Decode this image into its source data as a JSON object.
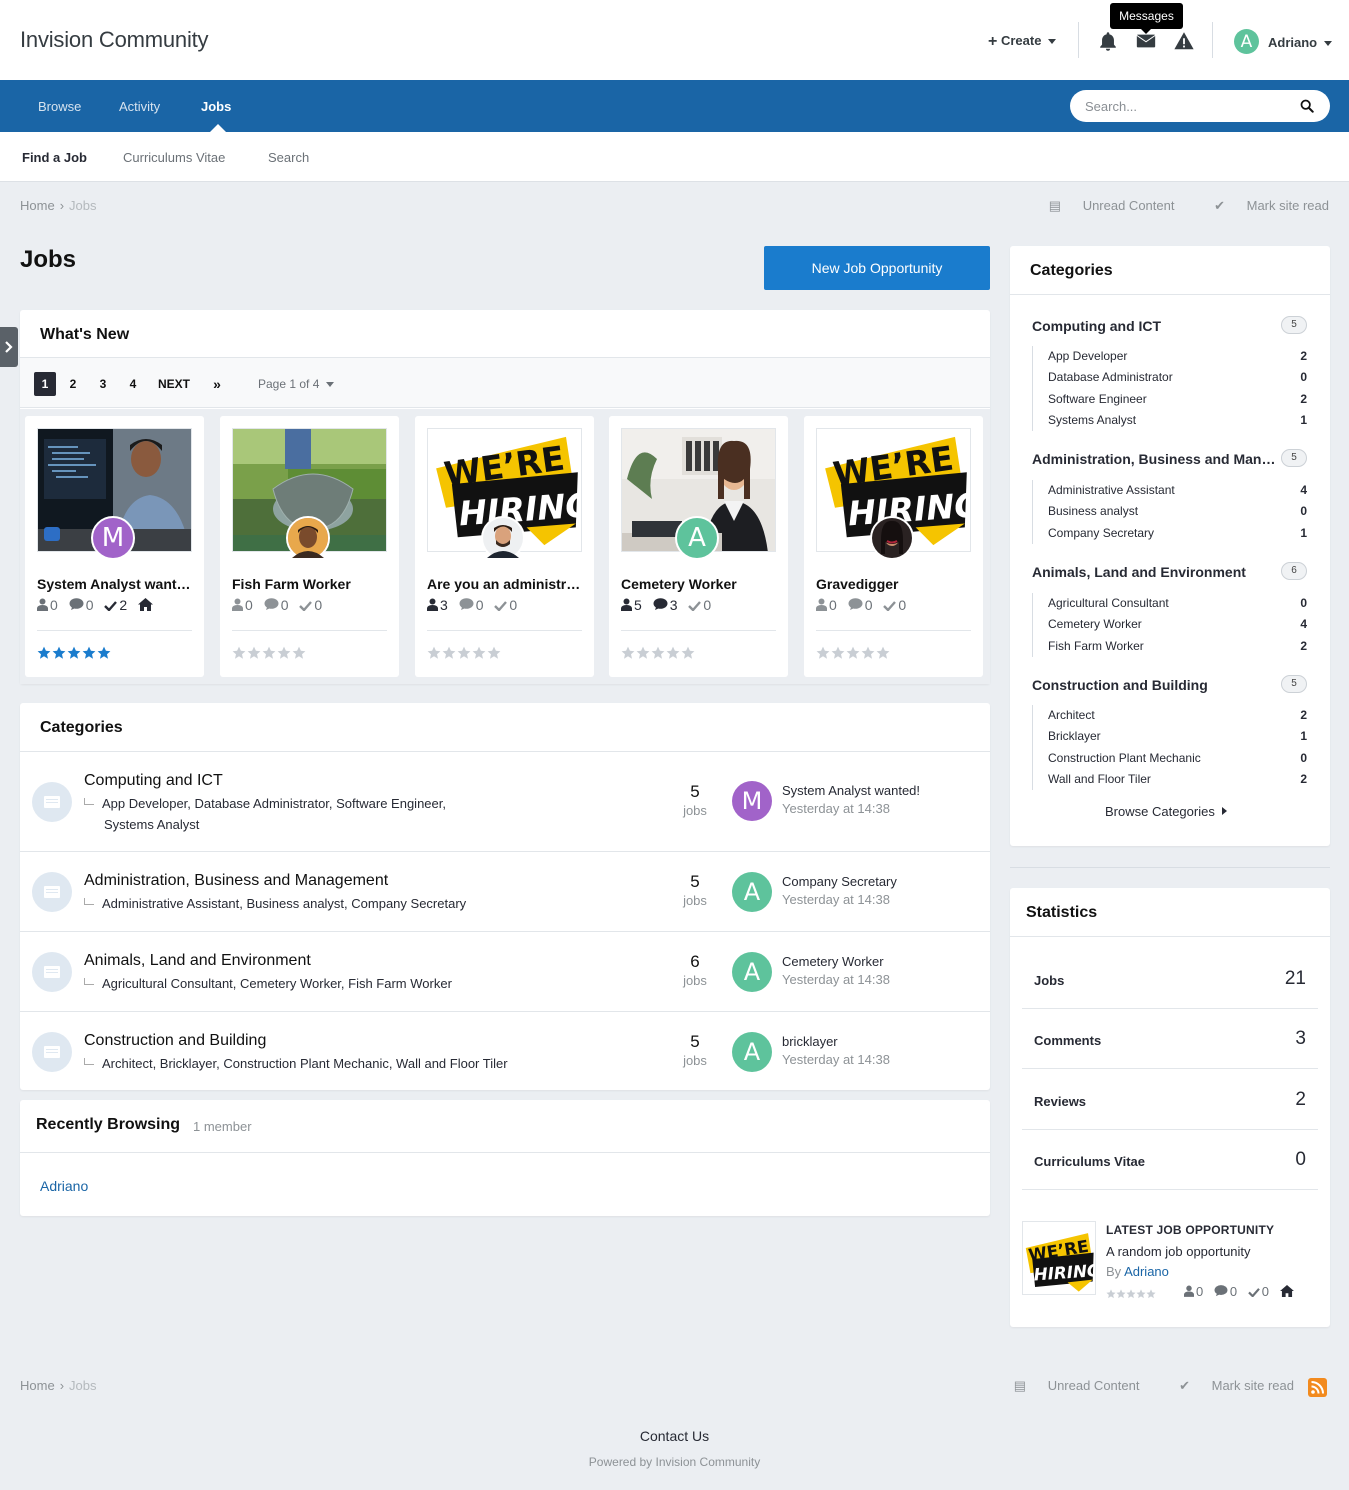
{
  "header": {
    "site_title": "Invision Community",
    "create_label": "Create",
    "tooltip": "Messages",
    "user_initial": "A",
    "user_name": "Adriano"
  },
  "nav": {
    "items": [
      "Browse",
      "Activity",
      "Jobs"
    ],
    "active": "Jobs",
    "search_placeholder": "Search..."
  },
  "subnav": {
    "items": [
      "Find a Job",
      "Curriculums Vitae",
      "Search"
    ],
    "active": "Find a Job"
  },
  "breadcrumb": {
    "home": "Home",
    "current": "Jobs",
    "unread": "Unread Content",
    "mark_read": "Mark site read"
  },
  "page": {
    "title": "Jobs",
    "new_button": "New Job Opportunity"
  },
  "whats_new": {
    "title": "What's New",
    "pages": [
      "1",
      "2",
      "3",
      "4"
    ],
    "next": "NEXT",
    "page_of": "Page 1 of 4",
    "cards": [
      {
        "title": "System Analyst wanted!",
        "avatar": "M",
        "avatar_color": "#a163c9",
        "stats": {
          "users": "0",
          "comments": "0",
          "checks": "2"
        },
        "featured": true,
        "rating": 5
      },
      {
        "title": "Fish Farm Worker",
        "avatar": "",
        "avatar_color": "#c57b3b",
        "stats": {
          "users": "0",
          "comments": "0",
          "checks": "0"
        },
        "featured": false,
        "rating": 0
      },
      {
        "title": "Are you an administrator?",
        "avatar": "",
        "avatar_color": "#6b4a3b",
        "stats": {
          "users": "3",
          "comments": "0",
          "checks": "0"
        },
        "featured": false,
        "rating": 0
      },
      {
        "title": "Cemetery Worker",
        "avatar": "A",
        "avatar_color": "#5ec39c",
        "stats": {
          "users": "5",
          "comments": "3",
          "checks": "0"
        },
        "featured": false,
        "rating": 0
      },
      {
        "title": "Gravedigger",
        "avatar": "",
        "avatar_color": "#4a2a2a",
        "stats": {
          "users": "0",
          "comments": "0",
          "checks": "0"
        },
        "featured": false,
        "rating": 0
      }
    ]
  },
  "hiring_text": {
    "line1": "WE’RE",
    "line2": "HIRING"
  },
  "categories": {
    "title": "Categories",
    "unit": "jobs",
    "rows": [
      {
        "name": "Computing and ICT",
        "subs": "App Developer,  Database Administrator,  Software Engineer,",
        "subs2": "Systems Analyst",
        "count": "5",
        "last_title": "System Analyst wanted!",
        "last_time": "Yesterday at 14:38",
        "avatar": "M",
        "avatar_color": "#a163c9"
      },
      {
        "name": "Administration, Business and Management",
        "subs": "Administrative Assistant,  Business analyst,  Company Secretary",
        "subs2": "",
        "count": "5",
        "last_title": "Company Secretary",
        "last_time": "Yesterday at 14:38",
        "avatar": "A",
        "avatar_color": "#5ec39c"
      },
      {
        "name": "Animals, Land and Environment",
        "subs": "Agricultural Consultant,  Cemetery Worker,  Fish Farm Worker",
        "subs2": "",
        "count": "6",
        "last_title": "Cemetery Worker",
        "last_time": "Yesterday at 14:38",
        "avatar": "A",
        "avatar_color": "#5ec39c"
      },
      {
        "name": "Construction and Building",
        "subs": "Architect,  Bricklayer,  Construction Plant Mechanic,  Wall and Floor Tiler",
        "subs2": "",
        "count": "5",
        "last_title": "bricklayer",
        "last_time": "Yesterday at 14:38",
        "avatar": "A",
        "avatar_color": "#5ec39c"
      }
    ]
  },
  "recently": {
    "title": "Recently Browsing",
    "count": "1 member",
    "user": "Adriano"
  },
  "side_categories": {
    "title": "Categories",
    "groups": [
      {
        "name": "Computing and ICT",
        "count": "5",
        "items": [
          [
            "App Developer",
            "2"
          ],
          [
            "Database Administrator",
            "0"
          ],
          [
            "Software Engineer",
            "2"
          ],
          [
            "Systems Analyst",
            "1"
          ]
        ]
      },
      {
        "name": "Administration, Business and Management",
        "count": "5",
        "items": [
          [
            "Administrative Assistant",
            "4"
          ],
          [
            "Business analyst",
            "0"
          ],
          [
            "Company Secretary",
            "1"
          ]
        ]
      },
      {
        "name": "Animals, Land and Environment",
        "count": "6",
        "items": [
          [
            "Agricultural Consultant",
            "0"
          ],
          [
            "Cemetery Worker",
            "4"
          ],
          [
            "Fish Farm Worker",
            "2"
          ]
        ]
      },
      {
        "name": "Construction and Building",
        "count": "5",
        "items": [
          [
            "Architect",
            "2"
          ],
          [
            "Bricklayer",
            "1"
          ],
          [
            "Construction Plant Mechanic",
            "0"
          ],
          [
            "Wall and Floor Tiler",
            "2"
          ]
        ]
      }
    ],
    "browse": "Browse Categories"
  },
  "statistics": {
    "title": "Statistics",
    "rows": [
      [
        "Jobs",
        "21"
      ],
      [
        "Comments",
        "3"
      ],
      [
        "Reviews",
        "2"
      ],
      [
        "Curriculums Vitae",
        "0"
      ]
    ],
    "latest_heading": "LATEST JOB OPPORTUNITY",
    "latest_title": "A random job opportunity",
    "latest_by_prefix": "By",
    "latest_by_user": "Adriano",
    "latest_stats": {
      "users": "0",
      "comments": "0",
      "checks": "0"
    }
  },
  "footer": {
    "contact": "Contact Us",
    "powered": "Powered by Invision Community"
  },
  "colors": {
    "brand": "#1a65a6",
    "button": "#1a7ccd",
    "star_active": "#1a7ccd",
    "star_inactive": "#c9ced4"
  }
}
